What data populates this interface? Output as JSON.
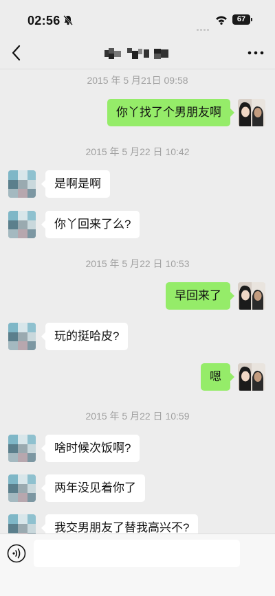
{
  "status_bar": {
    "time": "02:56",
    "battery": "67",
    "icons": [
      "bell-mute-icon",
      "signal-icon",
      "wifi-icon",
      "battery-icon"
    ]
  },
  "nav": {
    "icons": [
      "back-chevron-icon",
      "more-dots-icon"
    ]
  },
  "messages": [
    {
      "type": "timestamp",
      "text": "2015 年 5 月21日 09:58"
    },
    {
      "type": "outgoing",
      "text": "你丫找了个男朋友啊"
    },
    {
      "type": "timestamp",
      "text": "2015 年 5 月22 日 10:42"
    },
    {
      "type": "incoming",
      "text": "是啊是啊"
    },
    {
      "type": "incoming",
      "text": "你丫回来了么?"
    },
    {
      "type": "timestamp",
      "text": "2015 年 5 月22 日 10:53"
    },
    {
      "type": "outgoing",
      "text": "早回来了"
    },
    {
      "type": "incoming",
      "text": "玩的挺哈皮?"
    },
    {
      "type": "outgoing",
      "text": "嗯"
    },
    {
      "type": "timestamp",
      "text": "2015 年 5 月22 日 10:59"
    },
    {
      "type": "incoming",
      "text": "啥时候次饭啊?"
    },
    {
      "type": "incoming",
      "text": "两年没见着你了"
    },
    {
      "type": "incoming",
      "text": "我交男朋友了替我高兴不?"
    }
  ],
  "input_bar": {
    "value": "",
    "icons": [
      "voice-input-icon"
    ]
  },
  "colors": {
    "background": "#ededed",
    "outgoing_bubble": "#95ec69",
    "incoming_bubble": "#ffffff",
    "timestamp": "#a0a0a0"
  }
}
